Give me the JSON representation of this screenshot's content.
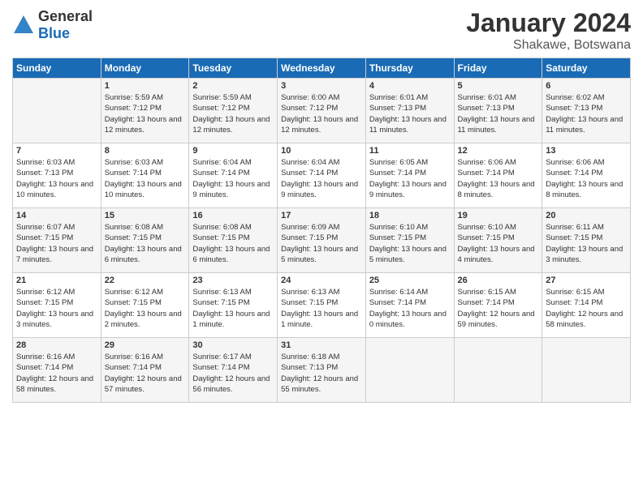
{
  "header": {
    "logo_general": "General",
    "logo_blue": "Blue",
    "title": "January 2024",
    "location": "Shakawe, Botswana"
  },
  "days_of_week": [
    "Sunday",
    "Monday",
    "Tuesday",
    "Wednesday",
    "Thursday",
    "Friday",
    "Saturday"
  ],
  "weeks": [
    [
      {
        "day": "",
        "sunrise": "",
        "sunset": "",
        "daylight": ""
      },
      {
        "day": "1",
        "sunrise": "Sunrise: 5:59 AM",
        "sunset": "Sunset: 7:12 PM",
        "daylight": "Daylight: 13 hours and 12 minutes."
      },
      {
        "day": "2",
        "sunrise": "Sunrise: 5:59 AM",
        "sunset": "Sunset: 7:12 PM",
        "daylight": "Daylight: 13 hours and 12 minutes."
      },
      {
        "day": "3",
        "sunrise": "Sunrise: 6:00 AM",
        "sunset": "Sunset: 7:12 PM",
        "daylight": "Daylight: 13 hours and 12 minutes."
      },
      {
        "day": "4",
        "sunrise": "Sunrise: 6:01 AM",
        "sunset": "Sunset: 7:13 PM",
        "daylight": "Daylight: 13 hours and 11 minutes."
      },
      {
        "day": "5",
        "sunrise": "Sunrise: 6:01 AM",
        "sunset": "Sunset: 7:13 PM",
        "daylight": "Daylight: 13 hours and 11 minutes."
      },
      {
        "day": "6",
        "sunrise": "Sunrise: 6:02 AM",
        "sunset": "Sunset: 7:13 PM",
        "daylight": "Daylight: 13 hours and 11 minutes."
      }
    ],
    [
      {
        "day": "7",
        "sunrise": "Sunrise: 6:03 AM",
        "sunset": "Sunset: 7:13 PM",
        "daylight": "Daylight: 13 hours and 10 minutes."
      },
      {
        "day": "8",
        "sunrise": "Sunrise: 6:03 AM",
        "sunset": "Sunset: 7:14 PM",
        "daylight": "Daylight: 13 hours and 10 minutes."
      },
      {
        "day": "9",
        "sunrise": "Sunrise: 6:04 AM",
        "sunset": "Sunset: 7:14 PM",
        "daylight": "Daylight: 13 hours and 9 minutes."
      },
      {
        "day": "10",
        "sunrise": "Sunrise: 6:04 AM",
        "sunset": "Sunset: 7:14 PM",
        "daylight": "Daylight: 13 hours and 9 minutes."
      },
      {
        "day": "11",
        "sunrise": "Sunrise: 6:05 AM",
        "sunset": "Sunset: 7:14 PM",
        "daylight": "Daylight: 13 hours and 9 minutes."
      },
      {
        "day": "12",
        "sunrise": "Sunrise: 6:06 AM",
        "sunset": "Sunset: 7:14 PM",
        "daylight": "Daylight: 13 hours and 8 minutes."
      },
      {
        "day": "13",
        "sunrise": "Sunrise: 6:06 AM",
        "sunset": "Sunset: 7:14 PM",
        "daylight": "Daylight: 13 hours and 8 minutes."
      }
    ],
    [
      {
        "day": "14",
        "sunrise": "Sunrise: 6:07 AM",
        "sunset": "Sunset: 7:15 PM",
        "daylight": "Daylight: 13 hours and 7 minutes."
      },
      {
        "day": "15",
        "sunrise": "Sunrise: 6:08 AM",
        "sunset": "Sunset: 7:15 PM",
        "daylight": "Daylight: 13 hours and 6 minutes."
      },
      {
        "day": "16",
        "sunrise": "Sunrise: 6:08 AM",
        "sunset": "Sunset: 7:15 PM",
        "daylight": "Daylight: 13 hours and 6 minutes."
      },
      {
        "day": "17",
        "sunrise": "Sunrise: 6:09 AM",
        "sunset": "Sunset: 7:15 PM",
        "daylight": "Daylight: 13 hours and 5 minutes."
      },
      {
        "day": "18",
        "sunrise": "Sunrise: 6:10 AM",
        "sunset": "Sunset: 7:15 PM",
        "daylight": "Daylight: 13 hours and 5 minutes."
      },
      {
        "day": "19",
        "sunrise": "Sunrise: 6:10 AM",
        "sunset": "Sunset: 7:15 PM",
        "daylight": "Daylight: 13 hours and 4 minutes."
      },
      {
        "day": "20",
        "sunrise": "Sunrise: 6:11 AM",
        "sunset": "Sunset: 7:15 PM",
        "daylight": "Daylight: 13 hours and 3 minutes."
      }
    ],
    [
      {
        "day": "21",
        "sunrise": "Sunrise: 6:12 AM",
        "sunset": "Sunset: 7:15 PM",
        "daylight": "Daylight: 13 hours and 3 minutes."
      },
      {
        "day": "22",
        "sunrise": "Sunrise: 6:12 AM",
        "sunset": "Sunset: 7:15 PM",
        "daylight": "Daylight: 13 hours and 2 minutes."
      },
      {
        "day": "23",
        "sunrise": "Sunrise: 6:13 AM",
        "sunset": "Sunset: 7:15 PM",
        "daylight": "Daylight: 13 hours and 1 minute."
      },
      {
        "day": "24",
        "sunrise": "Sunrise: 6:13 AM",
        "sunset": "Sunset: 7:15 PM",
        "daylight": "Daylight: 13 hours and 1 minute."
      },
      {
        "day": "25",
        "sunrise": "Sunrise: 6:14 AM",
        "sunset": "Sunset: 7:14 PM",
        "daylight": "Daylight: 13 hours and 0 minutes."
      },
      {
        "day": "26",
        "sunrise": "Sunrise: 6:15 AM",
        "sunset": "Sunset: 7:14 PM",
        "daylight": "Daylight: 12 hours and 59 minutes."
      },
      {
        "day": "27",
        "sunrise": "Sunrise: 6:15 AM",
        "sunset": "Sunset: 7:14 PM",
        "daylight": "Daylight: 12 hours and 58 minutes."
      }
    ],
    [
      {
        "day": "28",
        "sunrise": "Sunrise: 6:16 AM",
        "sunset": "Sunset: 7:14 PM",
        "daylight": "Daylight: 12 hours and 58 minutes."
      },
      {
        "day": "29",
        "sunrise": "Sunrise: 6:16 AM",
        "sunset": "Sunset: 7:14 PM",
        "daylight": "Daylight: 12 hours and 57 minutes."
      },
      {
        "day": "30",
        "sunrise": "Sunrise: 6:17 AM",
        "sunset": "Sunset: 7:14 PM",
        "daylight": "Daylight: 12 hours and 56 minutes."
      },
      {
        "day": "31",
        "sunrise": "Sunrise: 6:18 AM",
        "sunset": "Sunset: 7:13 PM",
        "daylight": "Daylight: 12 hours and 55 minutes."
      },
      {
        "day": "",
        "sunrise": "",
        "sunset": "",
        "daylight": ""
      },
      {
        "day": "",
        "sunrise": "",
        "sunset": "",
        "daylight": ""
      },
      {
        "day": "",
        "sunrise": "",
        "sunset": "",
        "daylight": ""
      }
    ]
  ]
}
